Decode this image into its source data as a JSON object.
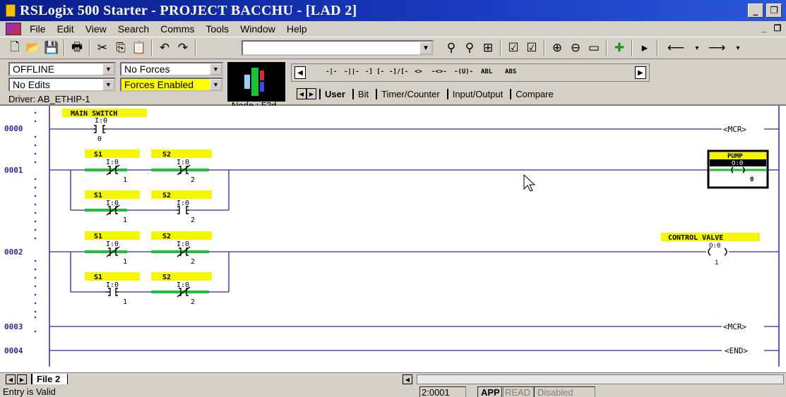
{
  "window": {
    "title": "RSLogix 500 Starter - PROJECT BACCHU - [LAD 2]"
  },
  "menu": [
    "File",
    "Edit",
    "View",
    "Search",
    "Comms",
    "Tools",
    "Window",
    "Help"
  ],
  "panel": {
    "mode": "OFFLINE",
    "edits": "No Edits",
    "forces": "No Forces",
    "forces_enabled": "Forces Enabled",
    "driver": "Driver: AB_ETHIP-1",
    "node": "Node : 52d"
  },
  "instruction_symbols": [
    "-|-",
    "-||-",
    "-] [-",
    "-]/[-",
    "<>",
    "-<>-",
    "-(U)-",
    "ABL",
    "ABS"
  ],
  "instruction_tabs": [
    "User",
    "Bit",
    "Timer/Counter",
    "Input/Output",
    "Compare"
  ],
  "rungs": {
    "r0000": "0000",
    "r0001": "0001",
    "r0002": "0002",
    "r0003": "0003",
    "r0004": "0004"
  },
  "ladder": {
    "main_switch": {
      "label": "MAIN SWITCH",
      "addr": "I:0",
      "bit": "0"
    },
    "mcr": "MCR",
    "end": "END",
    "s1": "S1",
    "s2": "S2",
    "input_addr": "I:0",
    "bit1": "1",
    "bit2": "2",
    "pump": {
      "label": "PUMP",
      "addr": "O:0",
      "bit": "0"
    },
    "control_valve": {
      "label": "CONTROL VALVE",
      "addr": "O:0",
      "bit": "1"
    }
  },
  "bottom": {
    "file_tab": "File 2",
    "status": "Entry is Valid",
    "position": "2:0001",
    "app": "APP",
    "read": "READ",
    "disabled": "Disabled"
  },
  "colors": {
    "rail": "#2a2a9a",
    "label_bg": "#f5f500",
    "energized": "#1fbf3a",
    "titlebar": "#0a1e8a",
    "chrome": "#d4d0c8"
  }
}
